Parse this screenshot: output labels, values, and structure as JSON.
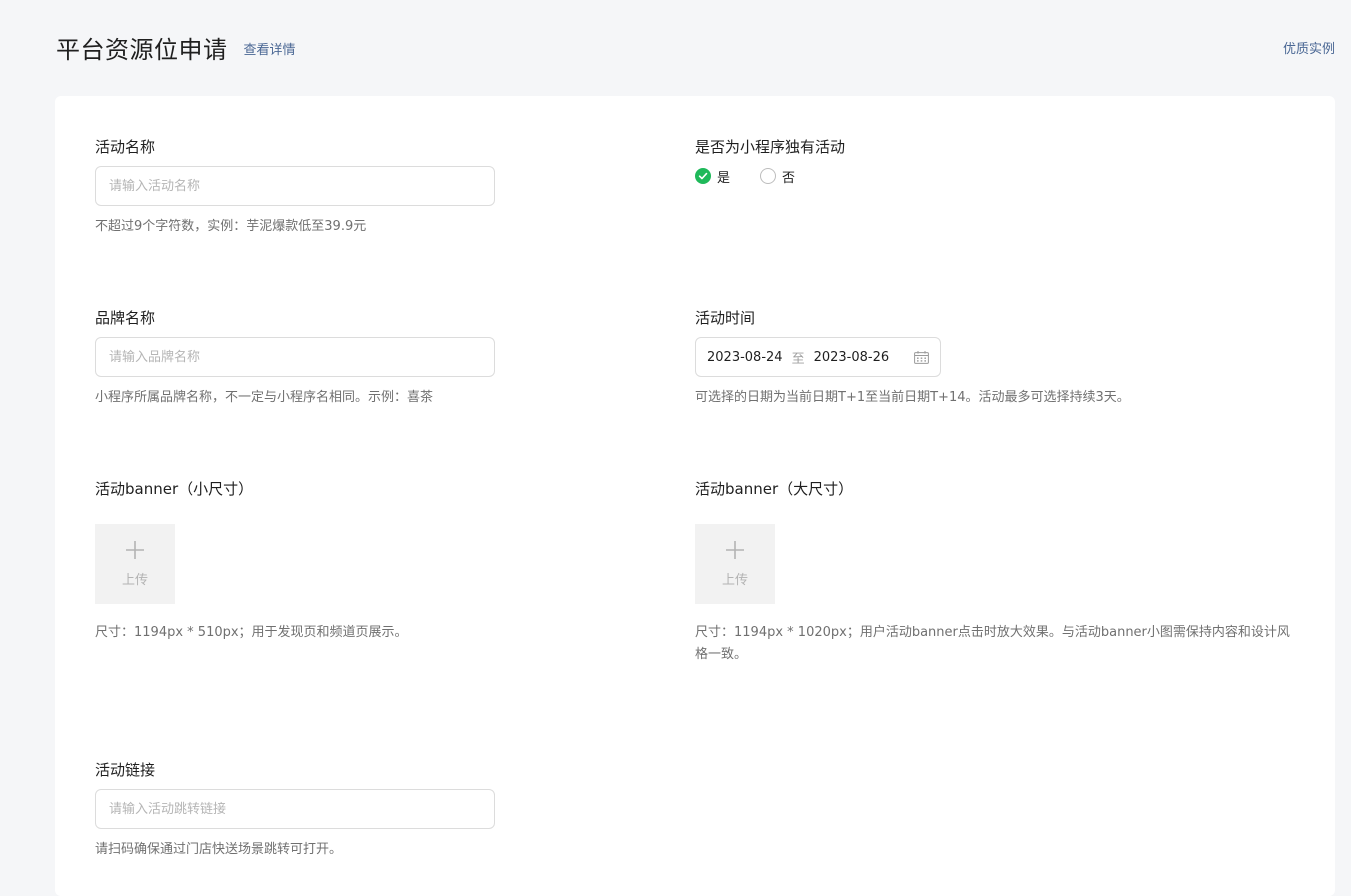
{
  "header": {
    "title": "平台资源位申请",
    "detail_link": "查看详情",
    "examples_link": "优质实例"
  },
  "form": {
    "activity_name": {
      "label": "活动名称",
      "placeholder": "请输入活动名称",
      "value": "",
      "hint": "不超过9个字符数，实例：芋泥爆款低至39.9元"
    },
    "exclusive": {
      "label": "是否为小程序独有活动",
      "options": [
        "是",
        "否"
      ],
      "selected": "是"
    },
    "brand_name": {
      "label": "品牌名称",
      "placeholder": "请输入品牌名称",
      "value": "",
      "hint": "小程序所属品牌名称，不一定与小程序名相同。示例：喜茶"
    },
    "activity_time": {
      "label": "活动时间",
      "start": "2023-08-24",
      "separator": "至",
      "end": "2023-08-26",
      "icon": "calendar-icon",
      "hint": "可选择的日期为当前日期T+1至当前日期T+14。活动最多可选择持续3天。"
    },
    "banner_small": {
      "label": "活动banner（小尺寸）",
      "upload_label": "上传",
      "icon": "plus-icon",
      "hint": "尺寸：1194px * 510px；用于发现页和频道页展示。"
    },
    "banner_large": {
      "label": "活动banner（大尺寸）",
      "upload_label": "上传",
      "icon": "plus-icon",
      "hint": "尺寸：1194px * 1020px；用户活动banner点击时放大效果。与活动banner小图需保持内容和设计风格一致。"
    },
    "activity_link": {
      "label": "活动链接",
      "placeholder": "请输入活动跳转链接",
      "value": "",
      "hint": "请扫码确保通过门店快送场景跳转可打开。"
    }
  },
  "colors": {
    "accent_green": "#1fb95a",
    "link_blue": "#4a6794",
    "background": "#f5f6f8"
  }
}
